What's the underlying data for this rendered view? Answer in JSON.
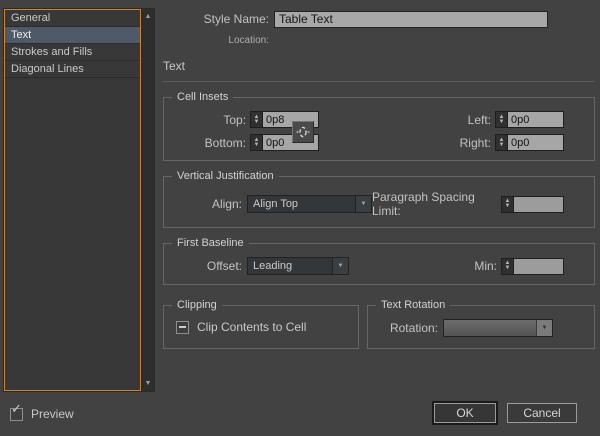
{
  "colors": {
    "dialog_bg": "#424242",
    "focus_border_orange": "#cd852f",
    "selection_blue_gray": "#4e5a68",
    "field_bg": "#a8a8a8"
  },
  "icons": {
    "check": "✓",
    "dropdown_arrow": "▼",
    "stepper_up": "▲",
    "stepper_down": "▼",
    "scroll_up": "▲",
    "scroll_down": "▼",
    "link_icon_name": "make-all-settings-same-icon"
  },
  "sidebar": {
    "items": [
      {
        "label": "General",
        "selected": false
      },
      {
        "label": "Text",
        "selected": true
      },
      {
        "label": "Strokes and Fills",
        "selected": false
      },
      {
        "label": "Diagonal Lines",
        "selected": false
      }
    ]
  },
  "header": {
    "style_name_label": "Style Name:",
    "style_name_value": "Table Text",
    "location_label": "Location:",
    "location_value": ""
  },
  "section_title": "Text",
  "cell_insets": {
    "legend": "Cell Insets",
    "top_label": "Top:",
    "top_value": "0p8",
    "bottom_label": "Bottom:",
    "bottom_value": "0p0",
    "left_label": "Left:",
    "left_value": "0p0",
    "right_label": "Right:",
    "right_value": "0p0"
  },
  "vertical_justification": {
    "legend": "Vertical Justification",
    "align_label": "Align:",
    "align_value": "Align Top",
    "paragraph_spacing_limit_label": "Paragraph Spacing Limit:",
    "paragraph_spacing_limit_value": ""
  },
  "first_baseline": {
    "legend": "First Baseline",
    "offset_label": "Offset:",
    "offset_value": "Leading",
    "min_label": "Min:",
    "min_value": ""
  },
  "clipping": {
    "legend": "Clipping",
    "checkbox_label": "Clip Contents to Cell",
    "checkbox_state": "indeterminate"
  },
  "text_rotation": {
    "legend": "Text Rotation",
    "rotation_label": "Rotation:",
    "rotation_value": ""
  },
  "footer": {
    "preview_label": "Preview",
    "preview_checked": true,
    "ok_label": "OK",
    "cancel_label": "Cancel"
  }
}
